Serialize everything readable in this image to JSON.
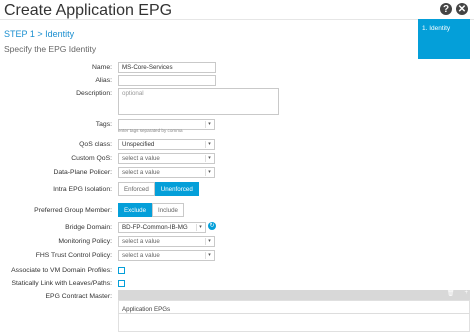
{
  "header": {
    "title": "Create Application EPG",
    "help_label": "?",
    "close_label": "✕"
  },
  "step": {
    "current": "STEP 1 > Identity",
    "sidebar_step": "1. Identity"
  },
  "subtitle": "Specify the EPG Identity",
  "form": {
    "name_label": "Name:",
    "name_value": "MS-Core-Services",
    "alias_label": "Alias:",
    "description_label": "Description:",
    "description_placeholder": "optional",
    "tags_label": "Tags:",
    "tags_hint": "enter tags separated by comma",
    "qos_label": "QoS class:",
    "qos_value": "Unspecified",
    "custom_qos_label": "Custom QoS:",
    "custom_qos_value": "select a value",
    "dp_policer_label": "Data-Plane Policer:",
    "dp_policer_value": "select a value",
    "isolation_label": "Intra EPG Isolation:",
    "isolation_options": [
      "Enforced",
      "Unenforced"
    ],
    "isolation_selected": "Unenforced",
    "pref_group_label": "Preferred Group Member:",
    "pref_group_options": [
      "Exclude",
      "Include"
    ],
    "pref_group_selected": "Exclude",
    "bridge_domain_label": "Bridge Domain:",
    "bridge_domain_value": "BD-FP-Common-IB-MG",
    "monitoring_label": "Monitoring Policy:",
    "monitoring_value": "select a value",
    "fhs_label": "FHS Trust Control Policy:",
    "fhs_value": "select a value",
    "vm_domain_label": "Associate to VM Domain Profiles:",
    "static_link_label": "Statically Link with Leaves/Paths:",
    "contract_master_label": "EPG Contract Master:"
  },
  "table": {
    "column": "Application EPGs",
    "delete_icon": "🗑",
    "add_icon": "+"
  }
}
